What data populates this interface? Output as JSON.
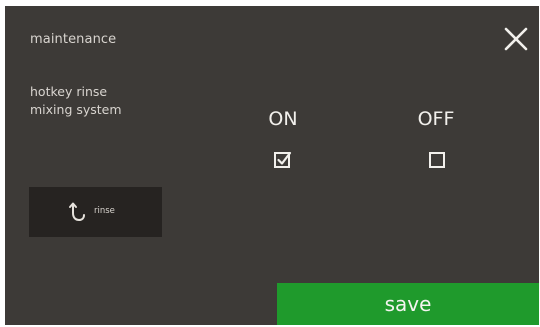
{
  "header": {
    "title": "maintenance"
  },
  "setting": {
    "label_line1": "hotkey rinse",
    "label_line2": "mixing system",
    "options": [
      {
        "label": "ON",
        "checked": true
      },
      {
        "label": "OFF",
        "checked": false
      }
    ]
  },
  "rinse_button": {
    "label": "rinse",
    "icon": "rinse-arrow-icon"
  },
  "footer": {
    "save_label": "save"
  },
  "colors": {
    "background": "#3d3a37",
    "button_dark": "#262321",
    "save_green": "#1f9a2c",
    "text_light": "#d8d4cf"
  }
}
